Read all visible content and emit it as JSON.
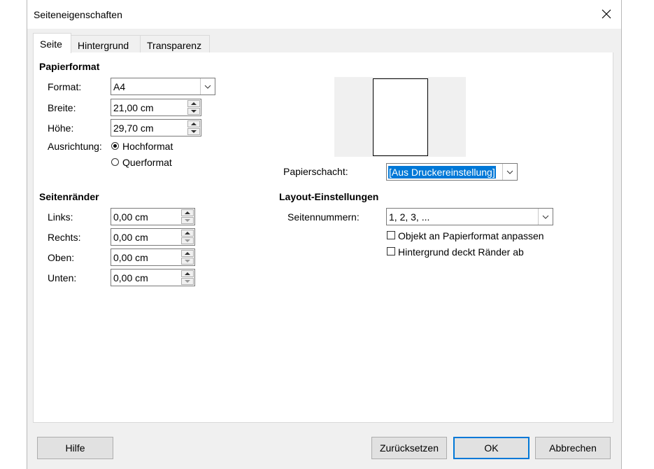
{
  "window": {
    "title": "Seiteneigenschaften"
  },
  "tabs": [
    {
      "label": "Seite",
      "active": true
    },
    {
      "label": "Hintergrund",
      "active": false
    },
    {
      "label": "Transparenz",
      "active": false
    }
  ],
  "paper": {
    "heading": "Papierformat",
    "format_label": "Format:",
    "format_value": "A4",
    "width_label": "Breite:",
    "width_value": "21,00 cm",
    "height_label": "Höhe:",
    "height_value": "29,70 cm",
    "orientation_label": "Ausrichtung:",
    "portrait_label": "Hochformat",
    "landscape_label": "Querformat",
    "tray_label": "Papierschacht:",
    "tray_value": "[Aus Druckereinstellung]"
  },
  "margins": {
    "heading": "Seitenränder",
    "left_label": "Links:",
    "left_value": "0,00 cm",
    "right_label": "Rechts:",
    "right_value": "0,00 cm",
    "top_label": "Oben:",
    "top_value": "0,00 cm",
    "bottom_label": "Unten:",
    "bottom_value": "0,00 cm"
  },
  "layout": {
    "heading": "Layout-Einstellungen",
    "numbering_label": "Seitennummern:",
    "numbering_value": "1, 2, 3, ...",
    "fit_label": "Objekt an Papierformat anpassen",
    "bg_label": "Hintergrund deckt Ränder ab"
  },
  "buttons": {
    "help": "Hilfe",
    "reset": "Zurücksetzen",
    "ok": "OK",
    "cancel": "Abbrechen"
  },
  "colors": {
    "accent": "#0078d7",
    "dialog_bg": "#f0f0f0"
  }
}
